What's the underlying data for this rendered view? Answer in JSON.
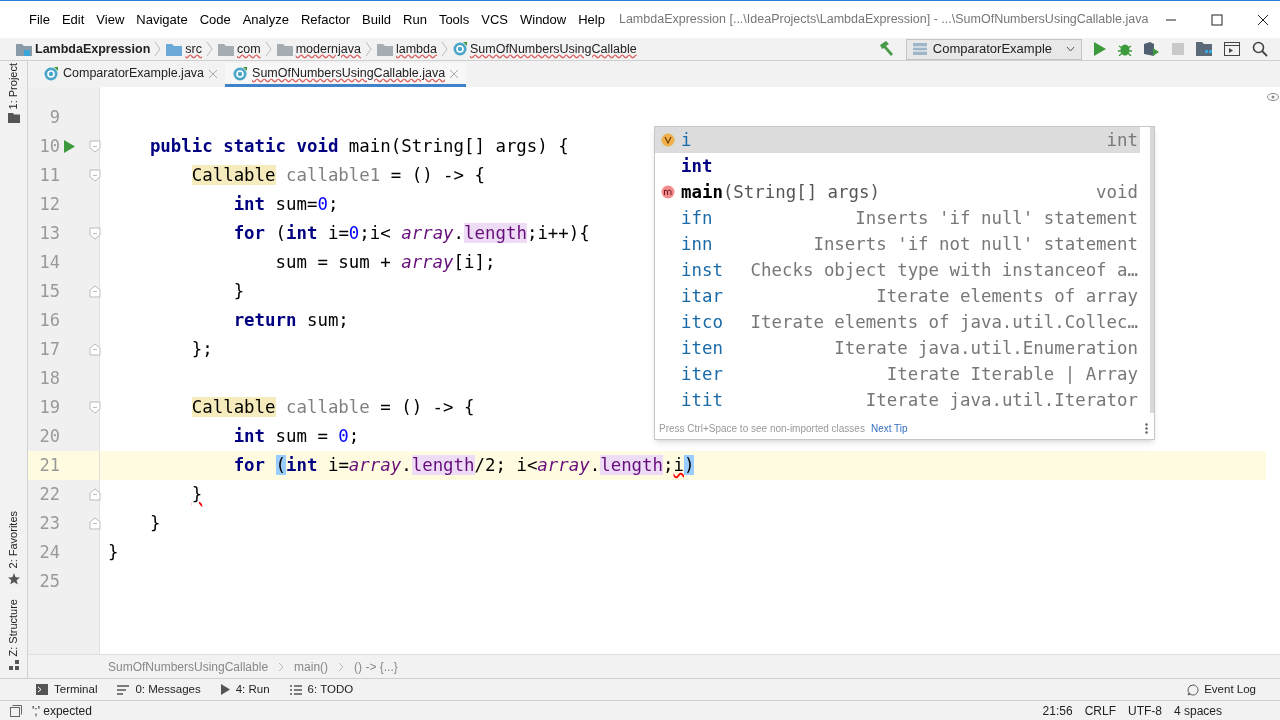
{
  "window": {
    "title": "LambdaExpression [...\\IdeaProjects\\LambdaExpression] - ...\\SumOfNumbersUsingCallable.java"
  },
  "menu": [
    "File",
    "Edit",
    "View",
    "Navigate",
    "Code",
    "Analyze",
    "Refactor",
    "Build",
    "Run",
    "Tools",
    "VCS",
    "Window",
    "Help"
  ],
  "navbar": {
    "crumbs": [
      {
        "kind": "project",
        "label": "LambdaExpression"
      },
      {
        "kind": "folder",
        "label": "src"
      },
      {
        "kind": "folder",
        "label": "com"
      },
      {
        "kind": "folder",
        "label": "modernjava"
      },
      {
        "kind": "folder",
        "label": "lambda"
      },
      {
        "kind": "class",
        "label": "SumOfNumbersUsingCallable"
      }
    ],
    "run_config": "ComparatorExample"
  },
  "tabs": [
    {
      "label": "ComparatorExample.java",
      "selected": false
    },
    {
      "label": "SumOfNumbersUsingCallable.java",
      "selected": true
    }
  ],
  "left_tools": [
    "1: Project",
    "2: Favorites",
    "Z: Structure"
  ],
  "editor": {
    "lines": [
      {
        "number": "9"
      },
      {
        "number": "10",
        "run": true,
        "fold_open": true,
        "tokens": [
          {
            "kind": "kw",
            "text": "    public static void "
          },
          {
            "kind": "plain",
            "text": "main(String[] args) {"
          }
        ]
      },
      {
        "number": "11",
        "fold_open": true,
        "tokens": [
          {
            "kind": "cls",
            "text": "        Callable"
          },
          {
            "kind": "unused",
            "text": " callable1"
          },
          {
            "kind": "plain",
            "text": " = () -> {"
          }
        ]
      },
      {
        "number": "12",
        "tokens": [
          {
            "kind": "kw",
            "text": "            int "
          },
          {
            "kind": "plain",
            "text": "sum="
          },
          {
            "kind": "num",
            "text": "0"
          },
          {
            "kind": "plain",
            "text": ";"
          }
        ]
      },
      {
        "number": "13",
        "fold_open": true,
        "tokens": [
          {
            "kind": "kw",
            "text": "            for "
          },
          {
            "kind": "plain",
            "text": "("
          },
          {
            "kind": "kw",
            "text": "int "
          },
          {
            "kind": "plain",
            "text": "i="
          },
          {
            "kind": "num",
            "text": "0"
          },
          {
            "kind": "plain",
            "text": ";i< "
          },
          {
            "kind": "static",
            "text": "array"
          },
          {
            "kind": "plain",
            "text": "."
          },
          {
            "kind": "field",
            "text": "length"
          },
          {
            "kind": "plain",
            "text": ";i++){"
          }
        ]
      },
      {
        "number": "14",
        "tokens": [
          {
            "kind": "plain",
            "text": "                sum = sum + "
          },
          {
            "kind": "static",
            "text": "array"
          },
          {
            "kind": "plain",
            "text": "[i];"
          }
        ]
      },
      {
        "number": "15",
        "fold_close": true,
        "tokens": [
          {
            "kind": "plain",
            "text": "            }"
          }
        ]
      },
      {
        "number": "16",
        "tokens": [
          {
            "kind": "kw",
            "text": "            return "
          },
          {
            "kind": "plain",
            "text": "sum;"
          }
        ]
      },
      {
        "number": "17",
        "fold_close": true,
        "tokens": [
          {
            "kind": "plain",
            "text": "        };"
          }
        ]
      },
      {
        "number": "18"
      },
      {
        "number": "19",
        "fold_open": true,
        "tokens": [
          {
            "kind": "cls",
            "text": "        Callable"
          },
          {
            "kind": "unused",
            "text": " callable"
          },
          {
            "kind": "plain",
            "text": " = () -> {"
          }
        ]
      },
      {
        "number": "20",
        "tokens": [
          {
            "kind": "kw",
            "text": "            int "
          },
          {
            "kind": "plain",
            "text": "sum = "
          },
          {
            "kind": "num",
            "text": "0"
          },
          {
            "kind": "plain",
            "text": ";"
          }
        ]
      },
      {
        "number": "21",
        "current": true,
        "tokens": [
          {
            "kind": "kw",
            "text": "            for "
          },
          {
            "kind": "match",
            "text": "("
          },
          {
            "kind": "kw",
            "text": "int "
          },
          {
            "kind": "plain",
            "text": "i="
          },
          {
            "kind": "static",
            "text": "array"
          },
          {
            "kind": "plain",
            "text": "."
          },
          {
            "kind": "field",
            "text": "length"
          },
          {
            "kind": "plain",
            "text": "/2; i<"
          },
          {
            "kind": "static",
            "text": "array"
          },
          {
            "kind": "plain",
            "text": "."
          },
          {
            "kind": "field",
            "text": "length"
          },
          {
            "kind": "plain",
            "text": ";"
          },
          {
            "kind": "error",
            "text": "i"
          },
          {
            "kind": "match",
            "text": ")"
          }
        ]
      },
      {
        "number": "22",
        "fold_close": true,
        "tokens": [
          {
            "kind": "error",
            "text": "        }"
          }
        ]
      },
      {
        "number": "23",
        "fold_close": true,
        "tokens": [
          {
            "kind": "plain",
            "text": "    }"
          }
        ]
      },
      {
        "number": "24",
        "tokens": [
          {
            "kind": "plain",
            "text": "}"
          }
        ]
      },
      {
        "number": "25"
      }
    ]
  },
  "completion": {
    "items": [
      {
        "kind": "variable",
        "selected": true,
        "name": "i",
        "detail": "int"
      },
      {
        "kind": "keyword",
        "selected": false,
        "name": "int"
      },
      {
        "kind": "method",
        "selected": false,
        "name": "main",
        "params": "(String[] args)",
        "detail": "void"
      },
      {
        "kind": "template",
        "selected": false,
        "name": "ifn",
        "detail": "Inserts 'if null' statement"
      },
      {
        "kind": "template",
        "selected": false,
        "name": "inn",
        "detail": "Inserts 'if not null' statement"
      },
      {
        "kind": "template",
        "selected": false,
        "name": "inst",
        "detail": "Checks object type with instanceof a…"
      },
      {
        "kind": "template",
        "selected": false,
        "name": "itar",
        "detail": "Iterate elements of array"
      },
      {
        "kind": "template",
        "selected": false,
        "name": "itco",
        "detail": "Iterate elements of java.util.Collec…"
      },
      {
        "kind": "template",
        "selected": false,
        "name": "iten",
        "detail": "Iterate java.util.Enumeration"
      },
      {
        "kind": "template",
        "selected": false,
        "name": "iter",
        "detail": "Iterate Iterable | Array"
      },
      {
        "kind": "template",
        "selected": false,
        "name": "itit",
        "detail": "Iterate java.util.Iterator"
      }
    ],
    "hint": "Press Ctrl+Space to see non-imported classes",
    "hint_link": "Next Tip"
  },
  "breadcrumbs": [
    "SumOfNumbersUsingCallable",
    "main()",
    "() -> {...}"
  ],
  "tool_windows": [
    {
      "kind": "terminal",
      "label": "Terminal"
    },
    {
      "kind": "messages",
      "label": "0: Messages"
    },
    {
      "kind": "run",
      "label": "4: Run"
    },
    {
      "kind": "todo",
      "label": "6: TODO"
    }
  ],
  "event_log": "Event Log",
  "status_bar": {
    "message": "';' expected",
    "items": [
      "21:56",
      "CRLF",
      "UTF-8",
      "4 spaces"
    ]
  }
}
